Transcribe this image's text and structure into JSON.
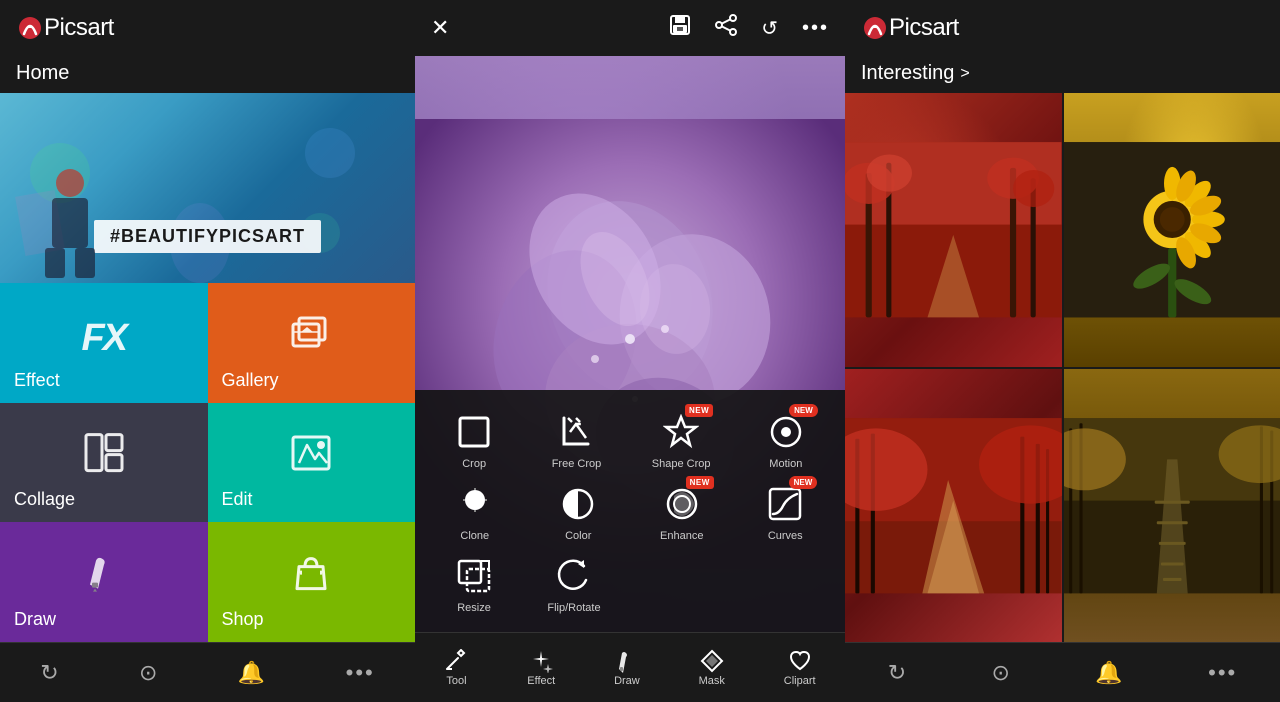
{
  "left": {
    "app_name": "Picsart",
    "section_title": "Home",
    "hero_text": "#BEAUTIFYPICSART",
    "tiles": [
      {
        "id": "effect",
        "label": "Effect",
        "color": "#00a8c6",
        "icon": "FX",
        "type": "fx"
      },
      {
        "id": "gallery",
        "label": "Gallery",
        "color": "#e05c1a",
        "icon": "🖼",
        "type": "gallery"
      },
      {
        "id": "collage",
        "label": "Collage",
        "color": "#3a3a4a",
        "icon": "⊞",
        "type": "collage"
      },
      {
        "id": "edit",
        "label": "Edit",
        "color": "#00b8a0",
        "icon": "🏔",
        "type": "edit"
      },
      {
        "id": "draw",
        "label": "Draw",
        "color": "#6a2a9a",
        "icon": "✏",
        "type": "draw"
      },
      {
        "id": "shop",
        "label": "Shop",
        "color": "#7ab800",
        "icon": "🛍",
        "type": "shop"
      }
    ],
    "bottom_icons": [
      "↻",
      "🔍",
      "🔔",
      "•••"
    ]
  },
  "middle": {
    "header_icons": [
      "✕",
      "💾",
      "↗",
      "↺",
      "•••"
    ],
    "tool_rows": [
      [
        {
          "id": "crop",
          "label": "Crop",
          "icon": "⬜",
          "new": false
        },
        {
          "id": "free-crop",
          "label": "Free Crop",
          "icon": "✂",
          "new": false
        },
        {
          "id": "shape-crop",
          "label": "Shape Crop",
          "icon": "★",
          "new": true
        },
        {
          "id": "motion",
          "label": "Motion",
          "icon": "⊙",
          "new": true
        }
      ],
      [
        {
          "id": "clone",
          "label": "Clone",
          "icon": "⬤",
          "new": false
        },
        {
          "id": "color",
          "label": "Color",
          "icon": "◑",
          "new": false
        },
        {
          "id": "enhance",
          "label": "Enhance",
          "icon": "◎",
          "new": true
        },
        {
          "id": "curves",
          "label": "Curves",
          "icon": "▣",
          "new": true
        }
      ],
      [
        {
          "id": "resize",
          "label": "Resize",
          "icon": "↔",
          "new": false
        },
        {
          "id": "flip-rotate",
          "label": "Flip/Rotate",
          "icon": "↩",
          "new": false
        }
      ]
    ],
    "bottom_tools": [
      {
        "id": "tool",
        "label": "Tool",
        "icon": "⚒"
      },
      {
        "id": "effect",
        "label": "Effect",
        "icon": "✦"
      },
      {
        "id": "draw",
        "label": "Draw",
        "icon": "✏"
      },
      {
        "id": "mask",
        "label": "Mask",
        "icon": "◇"
      },
      {
        "id": "clipart",
        "label": "Clipart",
        "icon": "♡"
      }
    ]
  },
  "right": {
    "app_name": "Picsart",
    "section_title": "Interesting",
    "section_arrow": ">",
    "bottom_icons": [
      "↻",
      "🔍",
      "🔔",
      "•••"
    ]
  }
}
